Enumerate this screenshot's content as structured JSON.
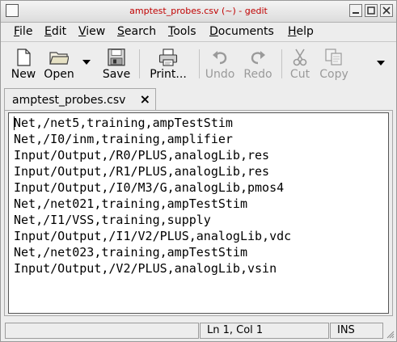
{
  "window": {
    "title": "amptest_probes.csv (~) - gedit",
    "title_color": "#c00000",
    "controls": [
      "minimize-icon",
      "maximize-icon",
      "close-icon"
    ]
  },
  "menubar": {
    "items": [
      {
        "label": "File"
      },
      {
        "label": "Edit"
      },
      {
        "label": "View"
      },
      {
        "label": "Search"
      },
      {
        "label": "Tools"
      },
      {
        "label": "Documents"
      },
      {
        "label": "Help"
      }
    ]
  },
  "toolbar": {
    "new_label": "New",
    "open_label": "Open",
    "save_label": "Save",
    "print_label": "Print...",
    "undo_label": "Undo",
    "redo_label": "Redo",
    "cut_label": "Cut",
    "copy_label": "Copy",
    "disabled_color": "#9a9a9a"
  },
  "tabs": [
    {
      "label": "amptest_probes.csv"
    }
  ],
  "editor": {
    "lines": [
      "Net,/net5,training,ampTestStim",
      "Net,/I0/inm,training,amplifier",
      "Input/Output,/R0/PLUS,analogLib,res",
      "Input/Output,/R1/PLUS,analogLib,res",
      "Input/Output,/I0/M3/G,analogLib,pmos4",
      "Net,/net021,training,ampTestStim",
      "Net,/I1/VSS,training,supply",
      "Input/Output,/I1/V2/PLUS,analogLib,vdc",
      "Net,/net023,training,ampTestStim",
      "Input/Output,/V2/PLUS,analogLib,vsin"
    ]
  },
  "statusbar": {
    "position": "Ln 1, Col 1",
    "mode": "INS"
  }
}
